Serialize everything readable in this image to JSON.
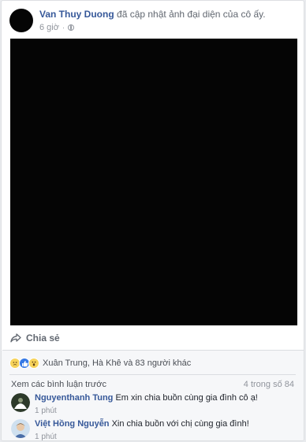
{
  "post": {
    "author": "Van Thuy Duong",
    "action_text": "đã cập nhật ảnh đại diện của cô ấy.",
    "time": "6 giờ",
    "separator": "·"
  },
  "share": {
    "label": "Chia sẻ"
  },
  "reactions": {
    "icons": [
      "sad-icon",
      "like-icon",
      "wow-icon"
    ],
    "text": "Xuân Trung, Hà Khê và 83 người khác"
  },
  "comments_section": {
    "view_previous": "Xem các bình luận trước",
    "count_text": "4 trong số 84",
    "comments": [
      {
        "name": "Nguyenthanh Tung",
        "text": "Em xin chia buồn cùng gia đình cô ạ!",
        "time": "1 phút"
      },
      {
        "name": "Việt Hồng Nguyễn",
        "text": "Xin chia buồn với chị cùng gia đình!",
        "time": "1 phút"
      }
    ]
  },
  "colors": {
    "link": "#365899",
    "muted": "#90949c",
    "photo": "#050505",
    "background": "#e9ebee"
  }
}
